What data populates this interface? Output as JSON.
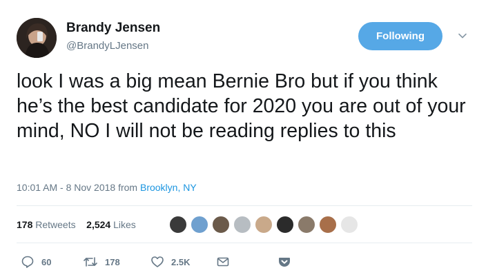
{
  "author": {
    "name": "Brandy Jensen",
    "handle": "@BrandyLJensen"
  },
  "follow_button": {
    "label": "Following"
  },
  "menu": {
    "icon": "chevron-down-icon"
  },
  "tweet": {
    "text": "look I was a big mean Bernie Bro but if you think he’s the best candidate for 2020 you are out of your mind, NO I will not be reading replies to this",
    "time_date": "10:01 AM - 8 Nov 2018 from ",
    "location": "Brooklyn, NY"
  },
  "stats": {
    "retweets_count": "178",
    "retweets_label": "Retweets",
    "likes_count": "2,524",
    "likes_label": "Likes"
  },
  "likers": [
    {
      "icon": "avatar",
      "color": "#3a3a3a"
    },
    {
      "icon": "avatar",
      "color": "#6fa0cf"
    },
    {
      "icon": "avatar",
      "color": "#6b5a4a"
    },
    {
      "icon": "avatar",
      "color": "#b7bdc2"
    },
    {
      "icon": "avatar",
      "color": "#c9a98a"
    },
    {
      "icon": "avatar",
      "color": "#2b2b2b"
    },
    {
      "icon": "avatar",
      "color": "#8a7a6a"
    },
    {
      "icon": "avatar",
      "color": "#a86f4a"
    },
    {
      "icon": "avatar",
      "color": "#e6e6e6"
    }
  ],
  "actions": {
    "replies": "60",
    "retweets": "178",
    "likes": "2.5K"
  },
  "colors": {
    "accent": "#1b95e0",
    "follow_button_bg": "#56a8e6",
    "muted_text": "#657786",
    "divider": "#e6ecf0"
  }
}
